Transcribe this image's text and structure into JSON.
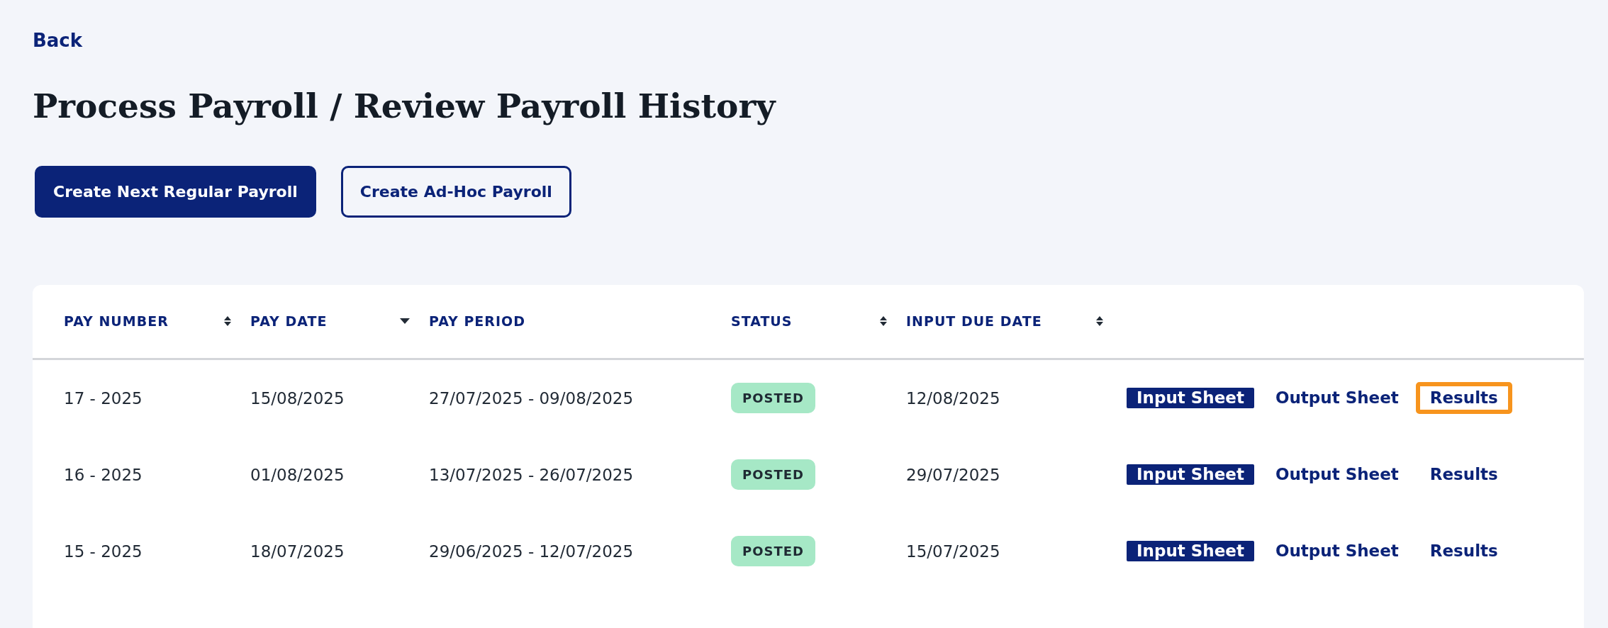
{
  "back_link": "Back",
  "title": "Process Payroll / Review Payroll History",
  "buttons": [
    {
      "label": "Create Next Regular Payroll",
      "kind": "primary"
    },
    {
      "label": "Create Ad-Hoc Payroll",
      "kind": "secondary"
    }
  ],
  "table": {
    "columns": [
      {
        "label": "PAY NUMBER",
        "kind": "sortable"
      },
      {
        "label": "PAY DATE",
        "kind": "descending"
      },
      {
        "label": "PAY PERIOD",
        "kind": "plain"
      },
      {
        "label": "STATUS",
        "kind": "sortable"
      },
      {
        "label": "INPUT DUE DATE",
        "kind": "sortable"
      }
    ],
    "rows": [
      {
        "pay_number": "17 - 2025",
        "pay_date": "15/08/2025",
        "pay_period": "27/07/2025 - 09/08/2025",
        "status": "POSTED",
        "input_due_date": "12/08/2025",
        "actions": [
          {
            "label": "Input Sheet",
            "kind": "filled",
            "highlighted": false
          },
          {
            "label": "Output Sheet",
            "kind": "link",
            "highlighted": false
          },
          {
            "label": "Results",
            "kind": "link",
            "highlighted": true
          }
        ]
      },
      {
        "pay_number": "16 - 2025",
        "pay_date": "01/08/2025",
        "pay_period": "13/07/2025 - 26/07/2025",
        "status": "POSTED",
        "input_due_date": "29/07/2025",
        "actions": [
          {
            "label": "Input Sheet",
            "kind": "filled",
            "highlighted": false
          },
          {
            "label": "Output Sheet",
            "kind": "link",
            "highlighted": false
          },
          {
            "label": "Results",
            "kind": "link",
            "highlighted": false
          }
        ]
      },
      {
        "pay_number": "15 - 2025",
        "pay_date": "18/07/2025",
        "pay_period": "29/06/2025 - 12/07/2025",
        "status": "POSTED",
        "input_due_date": "15/07/2025",
        "actions": [
          {
            "label": "Input Sheet",
            "kind": "filled",
            "highlighted": false
          },
          {
            "label": "Output Sheet",
            "kind": "link",
            "highlighted": false
          },
          {
            "label": "Results",
            "kind": "link",
            "highlighted": false
          }
        ]
      }
    ]
  }
}
